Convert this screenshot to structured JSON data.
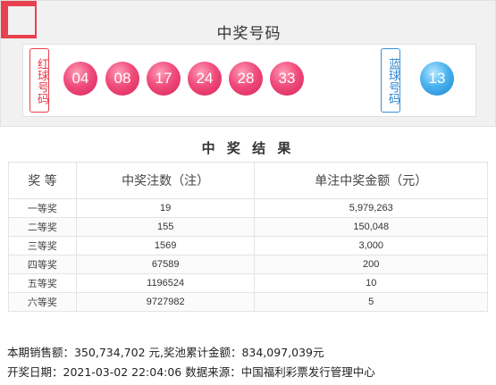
{
  "winning_numbers": {
    "title": "中奖号码",
    "red_label": "红球号码",
    "blue_label": "蓝球号码",
    "red_balls": [
      "04",
      "08",
      "17",
      "24",
      "28",
      "33"
    ],
    "blue_ball": "13"
  },
  "results": {
    "title": "中 奖 结 果",
    "headers": [
      "奖 等",
      "中奖注数（注）",
      "单注中奖金额（元）"
    ],
    "rows": [
      {
        "level": "一等奖",
        "count": "19",
        "amount": "5,979,263"
      },
      {
        "level": "二等奖",
        "count": "155",
        "amount": "150,048"
      },
      {
        "level": "三等奖",
        "count": "1569",
        "amount": "3,000"
      },
      {
        "level": "四等奖",
        "count": "67589",
        "amount": "200"
      },
      {
        "level": "五等奖",
        "count": "1196524",
        "amount": "10"
      },
      {
        "level": "六等奖",
        "count": "9727982",
        "amount": "5"
      }
    ]
  },
  "summary": {
    "sales_line": "本期销售额：350,734,702 元,奖池累计金额：834,097,039元",
    "draw_line": "开奖日期：2021-03-02 22:04:06 数据来源：中国福利彩票发行管理中心"
  },
  "colors": {
    "red_ball": "#e8406f",
    "blue_ball": "#3aa5e6",
    "accent": "#e8404e"
  }
}
